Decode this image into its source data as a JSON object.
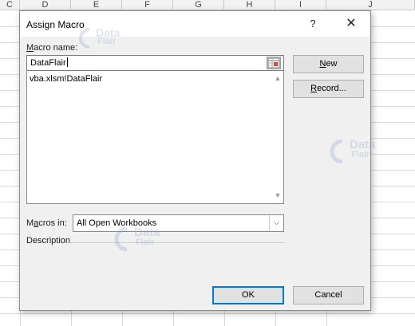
{
  "spreadsheet": {
    "columns": [
      "C",
      "D",
      "E",
      "F",
      "G",
      "H",
      "I",
      "J"
    ]
  },
  "dialog": {
    "title": "Assign Macro",
    "help_glyph": "?",
    "close_glyph": "✕",
    "macro_name": {
      "label_accel": "M",
      "label_rest": "acro name:",
      "value": "DataFlair"
    },
    "macro_list": {
      "items": [
        "vba.xlsm!DataFlair"
      ]
    },
    "macros_in": {
      "label_pre": "M",
      "label_accel": "a",
      "label_post": "cros in:",
      "value": "All Open Workbooks"
    },
    "description_label": "Description",
    "buttons": {
      "new_accel": "N",
      "new_rest": "ew",
      "record_accel": "R",
      "record_rest": "ecord...",
      "ok": "OK",
      "cancel": "Cancel"
    }
  },
  "watermark": {
    "line1": "Data",
    "line2": "Flair",
    "color": "#6a8cbf"
  },
  "colors": {
    "dialog_bg": "#f0f0f0",
    "default_button_border": "#0078d7",
    "grid": "#d9d9d9"
  }
}
